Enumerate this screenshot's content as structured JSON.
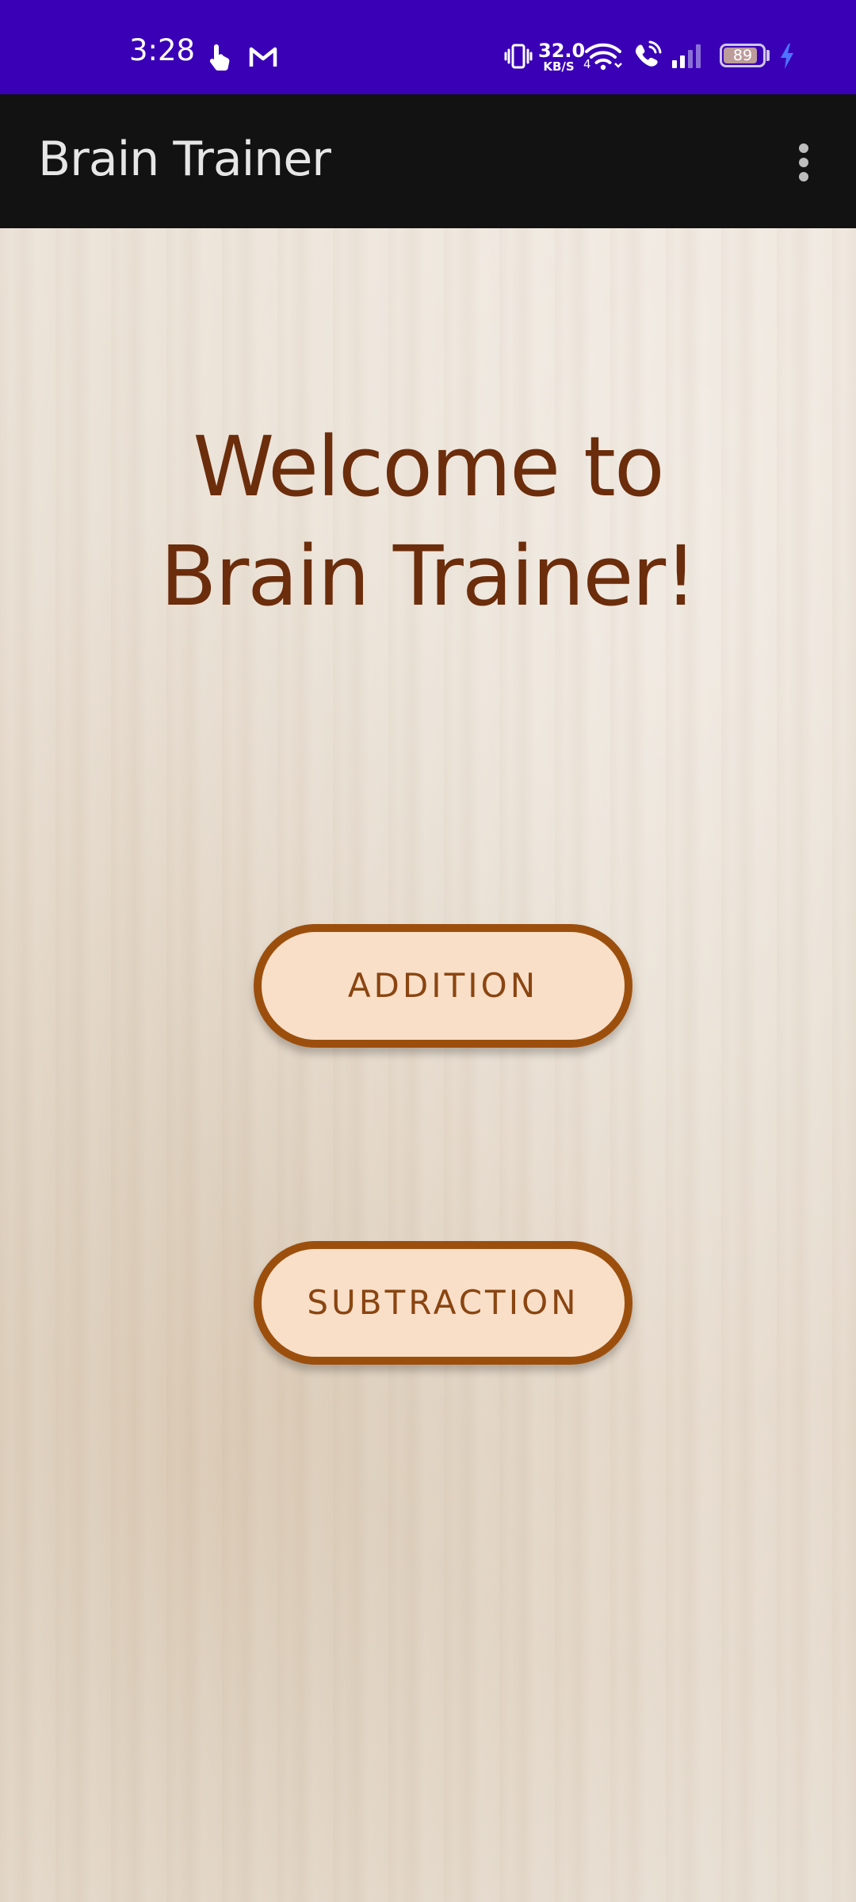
{
  "status_bar": {
    "time": "3:28",
    "network_speed_value": "32.0",
    "network_speed_unit": "KB/S",
    "wifi_label": "4",
    "battery_level": "89",
    "battery_fraction": 0.89,
    "icons": [
      "touch-gesture-icon",
      "gmail-icon",
      "vibrate-icon",
      "wifi-icon",
      "wifi-calling-icon",
      "signal-icon",
      "battery-icon",
      "charging-icon"
    ],
    "background_color": "#3a00b6"
  },
  "app_bar": {
    "title": "Brain Trainer",
    "menu_icon": "more-vert-icon",
    "background_color": "#121212"
  },
  "main": {
    "welcome_line1": "Welcome to",
    "welcome_line2": "Brain Trainer!",
    "title_color": "#6b2d0b",
    "buttons": [
      {
        "label": "ADDITION"
      },
      {
        "label": "SUBTRACTION"
      }
    ],
    "button_border_color": "#9c4f0d",
    "button_fill_color": "#f9dfc8"
  }
}
